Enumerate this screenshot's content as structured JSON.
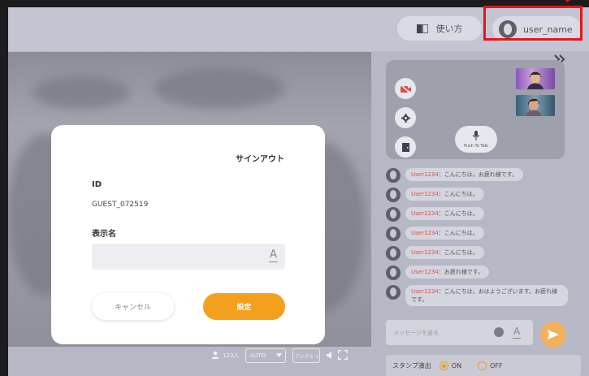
{
  "topbar": {
    "howto_label": "使い方",
    "user_label": "user_name"
  },
  "signout_dialog": {
    "title": "サインアウト",
    "id_label": "ID",
    "id_value": "GUEST_072519",
    "display_name_label": "表示名",
    "display_name_value": "",
    "cancel_label": "キャンセル",
    "confirm_label": "設定"
  },
  "video_controls": {
    "viewer_count": "123人",
    "quality_value": "AUTO",
    "angle_label": "アングル 1"
  },
  "conference": {
    "ptt_label": "Push To Talk"
  },
  "chat": {
    "messages": [
      {
        "user": "User1234",
        "text": "こんにちは。お疲れ様です。"
      },
      {
        "user": "User1234",
        "text": "こんにちは。"
      },
      {
        "user": "User1234",
        "text": "こんにちは。"
      },
      {
        "user": "User1234",
        "text": "こんにちは。"
      },
      {
        "user": "User1234",
        "text": "こんにちは。"
      },
      {
        "user": "User1234",
        "text": "お疲れ様です。"
      },
      {
        "user": "User1234",
        "text": "こんにちは。おはようございます。お疲れ様です。"
      }
    ],
    "separator": "：",
    "input_placeholder": "メッセージを送る"
  },
  "stamp": {
    "label": "スタンプ演出",
    "on_label": "ON",
    "off_label": "OFF",
    "selected": "ON"
  },
  "colors": {
    "accent": "#f3a01e",
    "highlight": "#e8141a",
    "chat_username": "#d9534f"
  }
}
